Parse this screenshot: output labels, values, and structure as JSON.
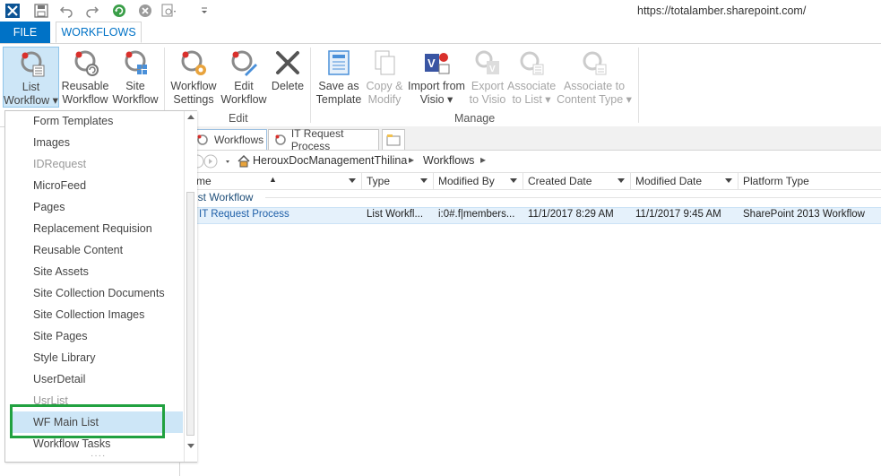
{
  "url": "https://totalamber.sharepoint.com/",
  "tabs": {
    "file": "FILE",
    "workflows": "WORKFLOWS"
  },
  "ribbon": {
    "new_buttons": [
      {
        "line1": "List",
        "line2": "Workflow ▾"
      },
      {
        "line1": "Reusable",
        "line2": "Workflow"
      },
      {
        "line1": "Site",
        "line2": "Workflow"
      }
    ],
    "edit_group": {
      "label": "Edit",
      "buttons": [
        {
          "line1": "Workflow",
          "line2": "Settings"
        },
        {
          "line1": "Edit",
          "line2": "Workflow"
        },
        {
          "line1": "Delete",
          "line2": ""
        }
      ]
    },
    "manage_group": {
      "label": "Manage",
      "buttons": [
        {
          "line1": "Save as",
          "line2": "Template",
          "enabled": true
        },
        {
          "line1": "Copy &",
          "line2": "Modify",
          "enabled": false
        },
        {
          "line1": "Import from",
          "line2": "Visio ▾",
          "enabled": true
        },
        {
          "line1": "Export",
          "line2": "to Visio",
          "enabled": false
        },
        {
          "line1": "Associate",
          "line2": "to List ▾",
          "enabled": false
        },
        {
          "line1": "Associate to",
          "line2": "Content Type ▾",
          "enabled": false
        }
      ]
    }
  },
  "doc_tabs": [
    "Workflows",
    "IT Request Process"
  ],
  "breadcrumb": [
    "HerouxDocManagementThilina",
    "Workflows"
  ],
  "grid": {
    "columns": [
      "me",
      "Type",
      "Modified By",
      "Created Date",
      "Modified Date",
      "Platform Type"
    ],
    "group_label": "ist Workflow",
    "row": {
      "name": "IT Request Process",
      "type": "List Workfl...",
      "modified_by": "i:0#.f|members...",
      "created": "11/1/2017 8:29 AM",
      "modified": "11/1/2017 9:45 AM",
      "platform": "SharePoint 2013 Workflow"
    }
  },
  "dropdown": {
    "items": [
      "Form Templates",
      "Images",
      "IDRequest",
      "MicroFeed",
      "Pages",
      "Replacement Requision",
      "Reusable Content",
      "Site Assets",
      "Site Collection Documents",
      "Site Collection Images",
      "Site Pages",
      "Style Library",
      "UserDetail",
      "UsrList",
      "WF Main List",
      "Workflow Tasks"
    ],
    "highlighted": "WF Main List"
  },
  "colors": {
    "accent": "#0072c6",
    "highlight": "#cde6f7",
    "callout": "#21a140"
  }
}
